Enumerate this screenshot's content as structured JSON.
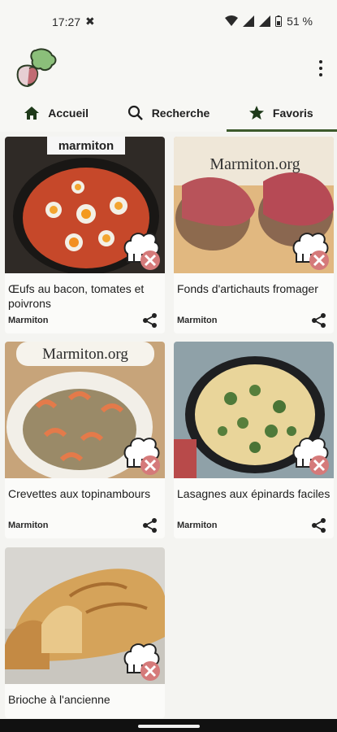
{
  "status": {
    "time": "17:27",
    "battery": "51 %"
  },
  "tabs": [
    {
      "label": "Accueil",
      "icon": "home-icon"
    },
    {
      "label": "Recherche",
      "icon": "search-icon"
    },
    {
      "label": "Favoris",
      "icon": "star-icon",
      "active": true
    }
  ],
  "recipes": [
    {
      "title": "Œufs au bacon, tomates et poivrons",
      "source": "Marmiton",
      "image_text": "marmiton"
    },
    {
      "title": "Fonds d'artichauts fromager",
      "source": "Marmiton",
      "image_text": "Marmiton.org"
    },
    {
      "title": "Crevettes aux topinambours",
      "source": "Marmiton",
      "image_text": "Marmiton.org"
    },
    {
      "title": "Lasagnes aux épinards faciles",
      "source": "Marmiton",
      "image_text": ""
    },
    {
      "title": "Brioche à l'ancienne",
      "source": "",
      "image_text": ""
    }
  ],
  "colors": {
    "accent": "#3d5a2c",
    "remove_badge": "#d57a7a"
  }
}
